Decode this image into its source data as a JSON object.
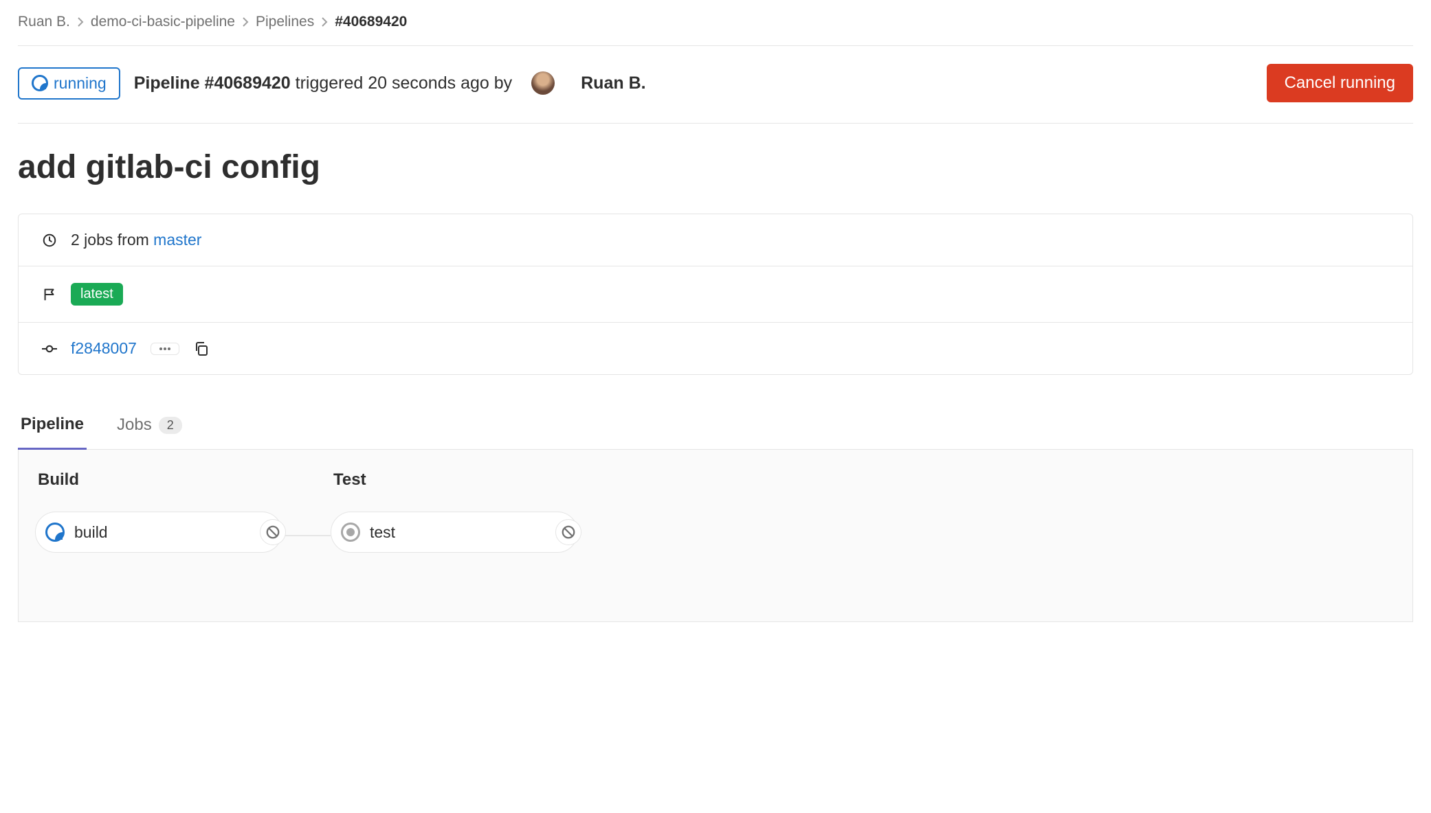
{
  "breadcrumb": {
    "user": "Ruan B.",
    "project": "demo-ci-basic-pipeline",
    "section": "Pipelines",
    "current": "#40689420"
  },
  "header": {
    "status_label": "running",
    "pipeline_prefix": "Pipeline ",
    "pipeline_id": "#40689420",
    "triggered_text": " triggered 20 seconds ago by",
    "user_name": "Ruan B.",
    "cancel_label": "Cancel running"
  },
  "title": "add gitlab-ci config",
  "info": {
    "jobs_text": "2 jobs from ",
    "branch": "master",
    "latest_badge": "latest",
    "commit_sha": "f2848007"
  },
  "tabs": {
    "pipeline": "Pipeline",
    "jobs": "Jobs",
    "jobs_count": "2"
  },
  "stages": {
    "build": {
      "name": "Build",
      "job": "build"
    },
    "test": {
      "name": "Test",
      "job": "test"
    }
  }
}
